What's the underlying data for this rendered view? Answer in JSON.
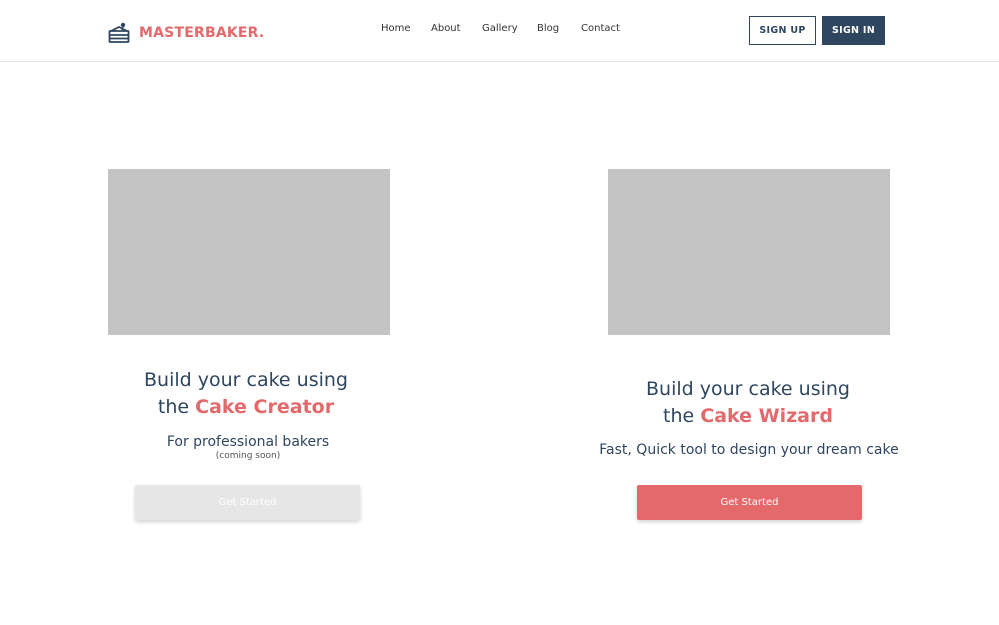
{
  "brand": {
    "name": "MASTERBAKER.",
    "icon": "cake-icon",
    "color": "#e4696b"
  },
  "nav": {
    "items": [
      {
        "label": "Home"
      },
      {
        "label": "About"
      },
      {
        "label": "Gallery"
      },
      {
        "label": "Blog"
      },
      {
        "label": "Contact"
      }
    ]
  },
  "auth": {
    "signup_label": "SIGN UP",
    "signin_label": "SIGN IN",
    "primary_color": "#2f4660"
  },
  "cards": [
    {
      "title_prefix": "Build your cake using",
      "title_the": "the",
      "title_highlight": "Cake Creator",
      "subtitle": "For professional bakers",
      "note": "(coming soon)",
      "button_label": "Get Started",
      "button_state": "disabled"
    },
    {
      "title_prefix": "Build your cake using",
      "title_the": "the",
      "title_highlight": "Cake Wizard",
      "subtitle": "Fast, Quick tool to design your dream cake",
      "button_label": "Get Started",
      "button_state": "enabled"
    }
  ],
  "colors": {
    "accent": "#e4696b",
    "navy": "#2f4660",
    "placeholder": "#c4c4c4",
    "disabled_button": "#e6e6e6"
  }
}
